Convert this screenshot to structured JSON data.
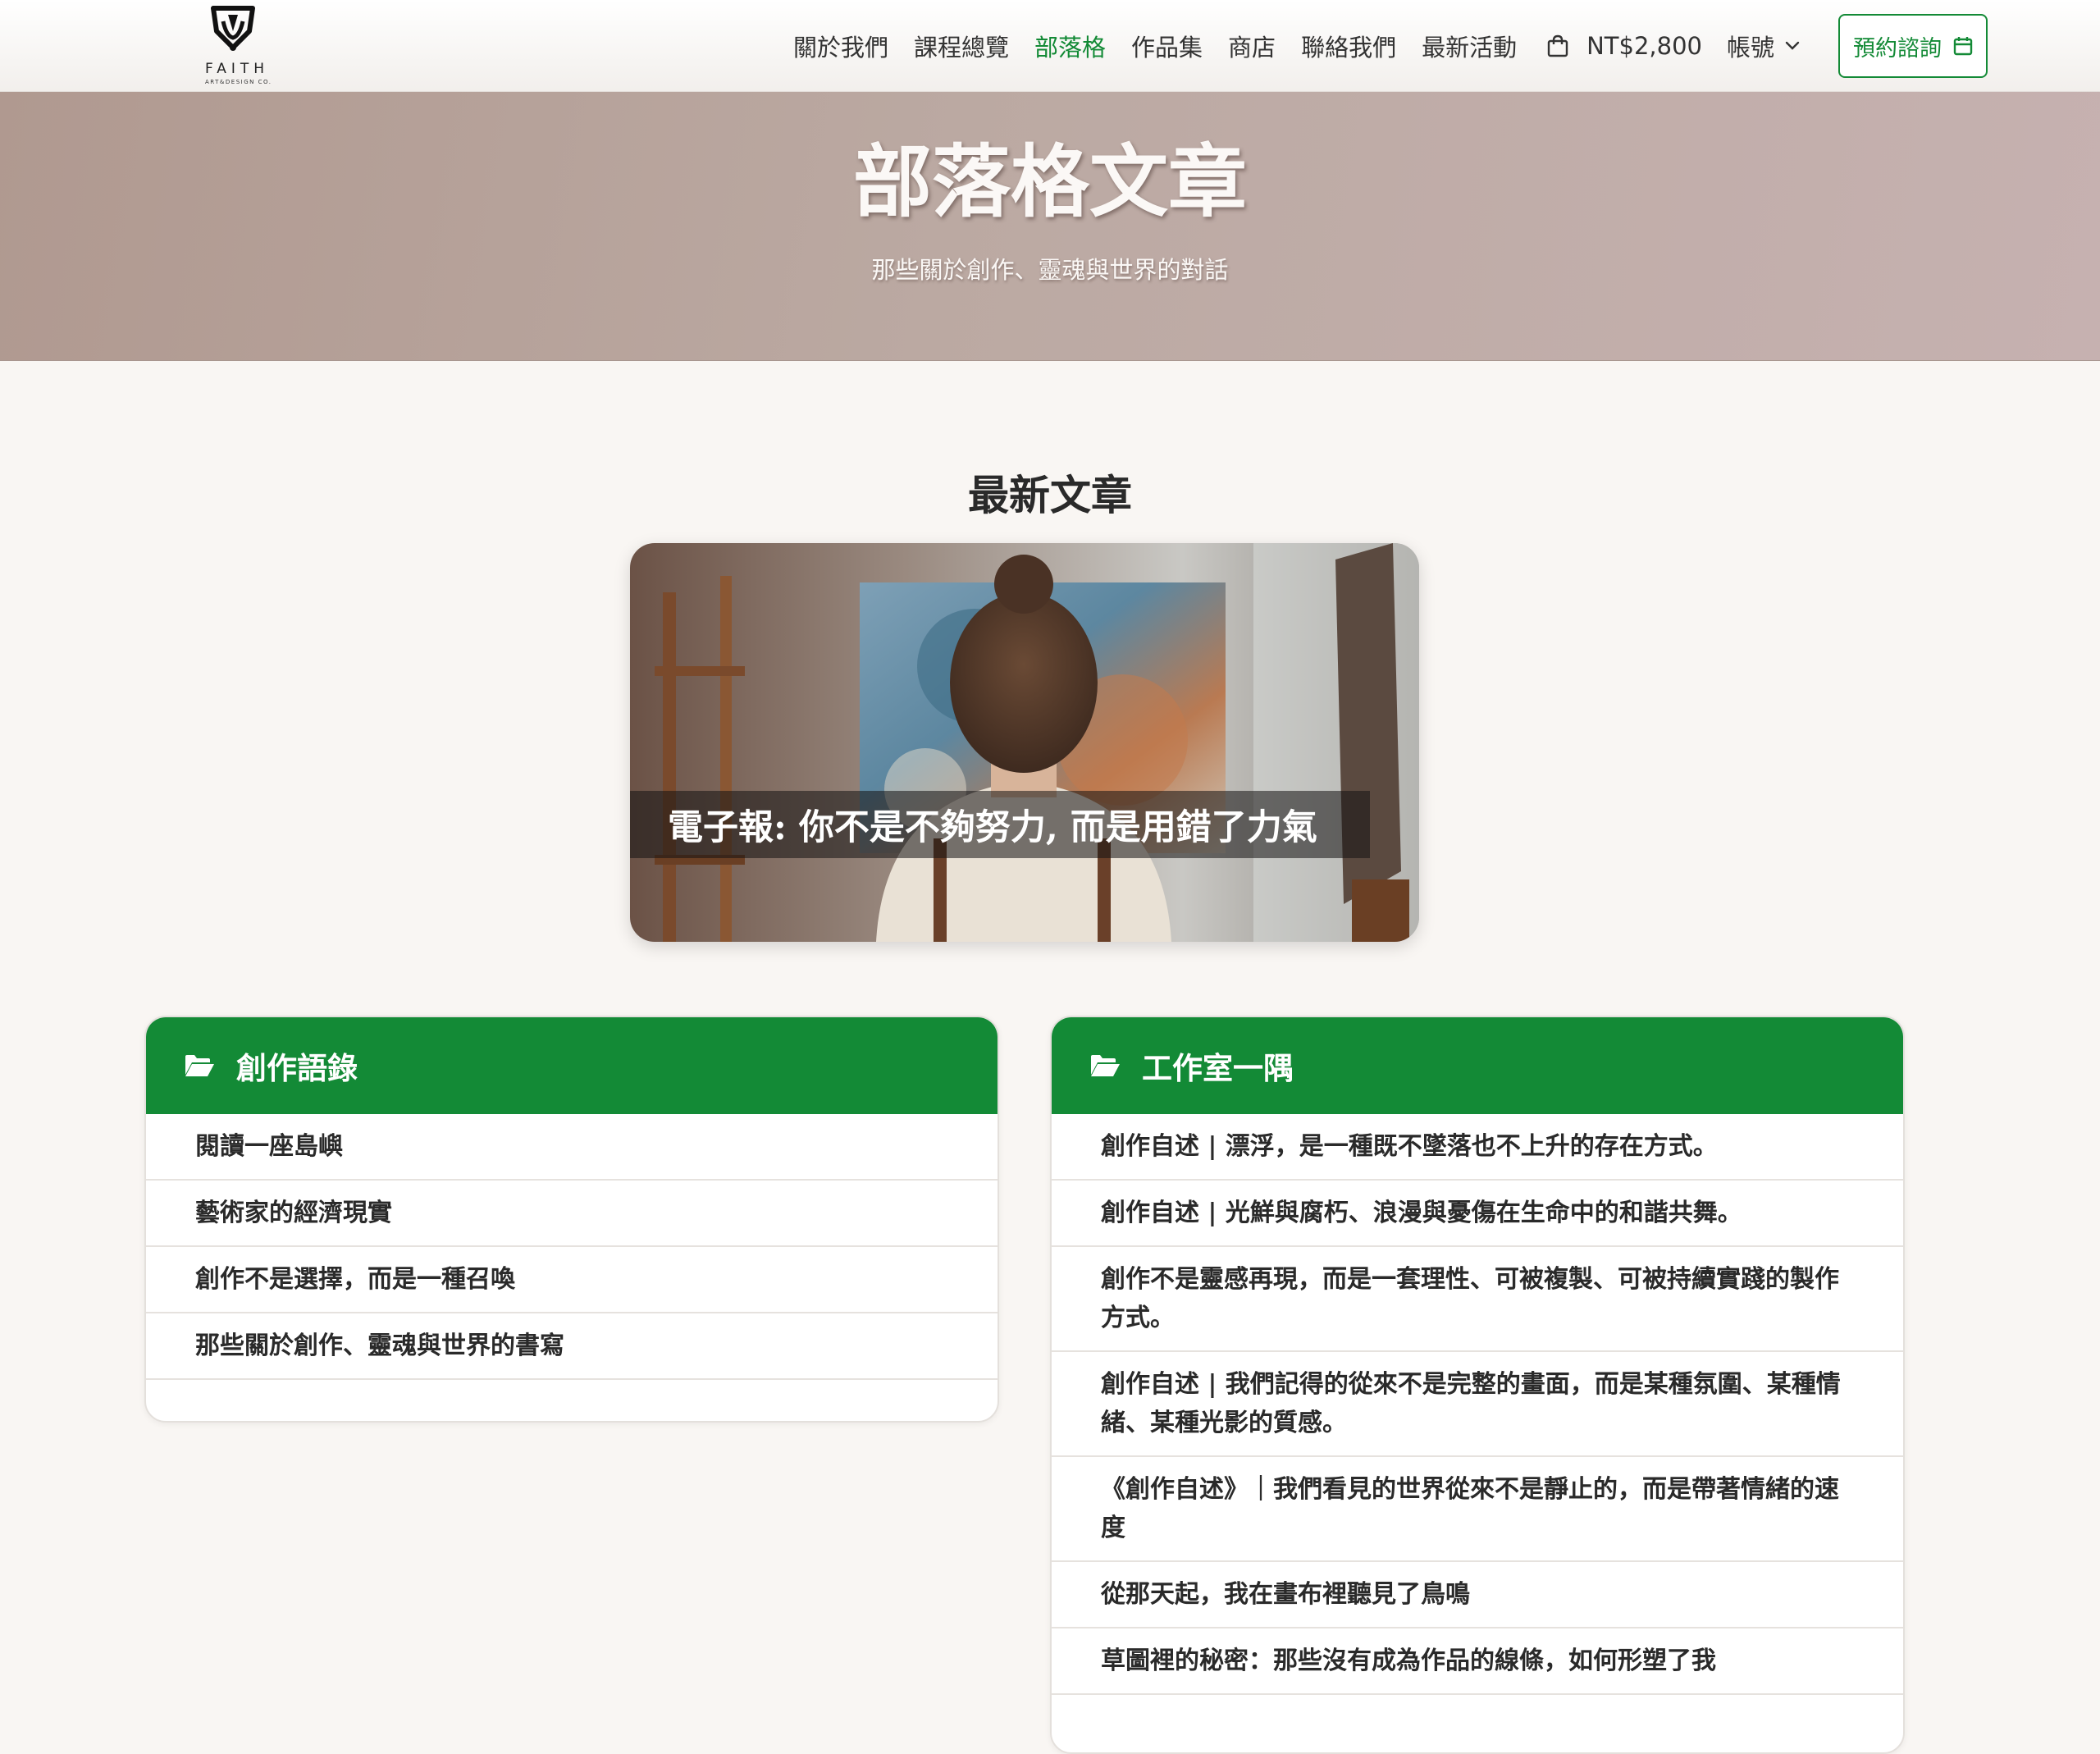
{
  "logo": {
    "word": "FAITH",
    "sub": "ART&DESIGN CO."
  },
  "nav": {
    "items": [
      "關於我們",
      "課程總覽",
      "部落格",
      "作品集",
      "商店",
      "聯絡我們",
      "最新活動"
    ],
    "active_index": 2,
    "cart_amount": "NT$2,800",
    "account_label": "帳號",
    "cta_label": "預約諮詢"
  },
  "hero": {
    "title": "部落格文章",
    "subtitle": "那些關於創作、靈魂與世界的對話"
  },
  "latest": {
    "heading": "最新文章",
    "feature_caption": "電子報: 你不是不夠努力, 而是用錯了力氣"
  },
  "categories": [
    {
      "title": "創作語錄",
      "posts": [
        "閱讀一座島嶼",
        "藝術家的經濟現實",
        "創作不是選擇，而是一種召喚",
        "那些關於創作、靈魂與世界的書寫"
      ]
    },
    {
      "title": "工作室一隅",
      "posts": [
        "創作自述 | 漂浮，是一種既不墜落也不上升的存在方式。",
        "創作自述 | 光鮮與腐朽、浪漫與憂傷在生命中的和諧共舞。",
        "創作不是靈感再現，而是一套理性、可被複製、可被持續實踐的製作方式。",
        "創作自述 | 我們記得的從來不是完整的畫面，而是某種氛圍、某種情緒、某種光影的質感。",
        "《創作自述》｜我們看見的世界從來不是靜止的，而是帶著情緒的速度",
        "從那天起，我在畫布裡聽見了鳥鳴",
        "草圖裡的秘密：那些沒有成為作品的線條，如何形塑了我"
      ]
    }
  ],
  "colors": {
    "accent": "#138a36",
    "hero_bg": "#bba9a2",
    "page_bg": "#f9f6f3"
  },
  "icons": [
    "faith-logo",
    "shopping-bag-icon",
    "chevron-down-icon",
    "calendar-icon",
    "folder-open-icon"
  ]
}
